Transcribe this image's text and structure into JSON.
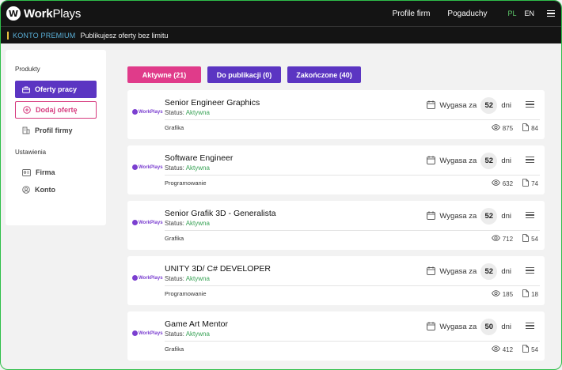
{
  "header": {
    "logo_mark": "W",
    "logo_work": "Work",
    "logo_plays": "Plays",
    "nav": [
      "Profile firm",
      "Pogaduchy"
    ],
    "lang_active": "PL",
    "lang_other": "EN"
  },
  "premium": {
    "badge": "KONTO PREMIUM",
    "message": "Publikujesz oferty bez limitu"
  },
  "sidebar": {
    "section1": "Produkty",
    "offers_button": "Oferty pracy",
    "add_button": "Dodaj ofertę",
    "company_profile": "Profil firmy",
    "section2": "Ustawienia",
    "company": "Firma",
    "account": "Konto"
  },
  "tabs": {
    "active": "Aktywne (21)",
    "pending": "Do publikacji (0)",
    "finished": "Zakończone (40)"
  },
  "job_labels": {
    "status_prefix": "Status: ",
    "expiry_prefix": "Wygasa za",
    "days_suffix": "dni",
    "company_logo_text": "WorkPlays"
  },
  "jobs": [
    {
      "title": "Senior Engineer Graphics",
      "status": "Aktywna",
      "category": "Grafika",
      "days": "52",
      "views": "875",
      "applications": "84"
    },
    {
      "title": "Software Engineer",
      "status": "Aktywna",
      "category": "Programowanie",
      "days": "52",
      "views": "632",
      "applications": "74"
    },
    {
      "title": "Senior Grafik 3D - Generalista",
      "status": "Aktywna",
      "category": "Grafika",
      "days": "52",
      "views": "712",
      "applications": "54"
    },
    {
      "title": "UNITY 3D/ C# DEVELOPER",
      "status": "Aktywna",
      "category": "Programowanie",
      "days": "52",
      "views": "185",
      "applications": "18"
    },
    {
      "title": "Game Art Mentor",
      "status": "Aktywna",
      "category": "Grafika",
      "days": "50",
      "views": "412",
      "applications": "54"
    }
  ],
  "colors": {
    "primary_purple": "#5b35c2",
    "accent_pink": "#e03b8a",
    "status_green": "#3aa357",
    "topbar": "#141414"
  }
}
